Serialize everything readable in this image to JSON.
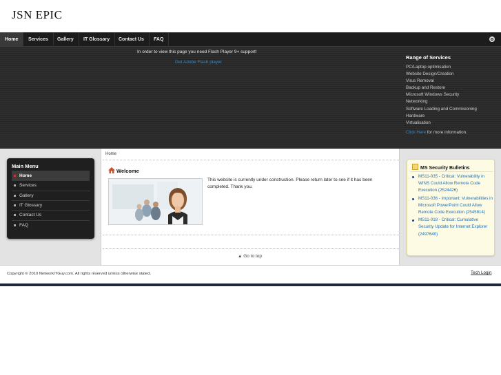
{
  "header": {
    "logo": "JSN EPIC"
  },
  "nav": {
    "items": [
      {
        "label": "Home"
      },
      {
        "label": "Services"
      },
      {
        "label": "Gallery"
      },
      {
        "label": "IT Glossary"
      },
      {
        "label": "Contact Us"
      },
      {
        "label": "FAQ"
      }
    ],
    "settings_icon": "gear-icon"
  },
  "banner": {
    "flash_message": "In order to view this page you need Flash Player 9+ support!",
    "flash_link": "Get Adobe Flash player",
    "services_title": "Range of Services",
    "services": [
      "PC/Laptop optimisation",
      "Website Design/Creation",
      "Virus Removal",
      "Backup and Restore",
      "Microsoft Windows Security",
      "Networking",
      "Software Loading and Commisioning",
      "Hardware",
      "Virtualisation"
    ],
    "more_link": "Click Here",
    "more_text": " for more information."
  },
  "mainmenu": {
    "title": "Main Menu",
    "items": [
      {
        "label": "Home"
      },
      {
        "label": "Services"
      },
      {
        "label": "Gallery"
      },
      {
        "label": "IT Glossary"
      },
      {
        "label": "Contact Us"
      },
      {
        "label": "FAQ"
      }
    ]
  },
  "content": {
    "breadcrumb": "Home",
    "heading": "Welcome",
    "body": "This website is currently under construction.  Please return later to see if it has been completed.  Thank you.",
    "go_top": "Go to top"
  },
  "bulletin": {
    "title": "MS Security Bulletins",
    "items": [
      "MS11-035 - Critical: Vulnerability in WINS Could Allow Remote Code Execution (2524426)",
      "MS11-036 - Important: Vulnerabilities in Microsoft PowerPoint Could Allow Remote Code Execution (2545814)",
      "MS11-018 - Critical: Cumulative Security Update for Internet Explorer (2497640)"
    ]
  },
  "footer": {
    "copyright": "Copyright © 2010 NetworkITGuy.com. All rights reserved unless otherwise stated.",
    "tech_login": "Tech Login"
  },
  "colors": {
    "nav_bg": "#1c1c1c",
    "link_blue": "#2a8fd6",
    "bulletin_bg": "#fefbe4"
  }
}
